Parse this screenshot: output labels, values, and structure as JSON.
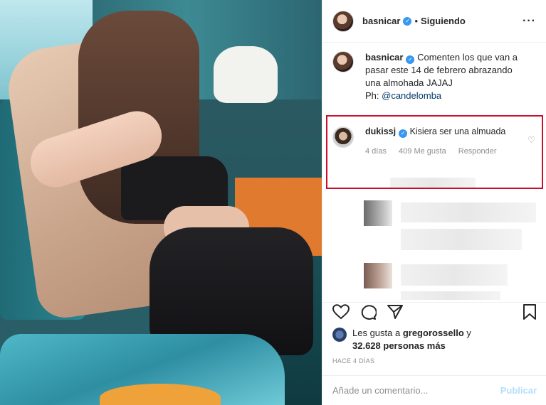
{
  "post": {
    "username": "basnicar",
    "following_label": "Siguiendo",
    "more_icon": "more-options-icon"
  },
  "caption": {
    "username": "basnicar",
    "text": "Comenten los que van a pasar este 14 de febrero abrazando una almohada JAJAJ",
    "credit_prefix": "Ph: ",
    "credit_mention": "@candelomba"
  },
  "highlighted_comment": {
    "username": "dukissj",
    "text": "Kisiera ser una almuada",
    "age": "4 días",
    "likes": "409 Me gusta",
    "reply_label": "Responder"
  },
  "likes": {
    "prefix": "Les gusta a ",
    "user": "gregorossello",
    "suffix": " y",
    "count": "32.628 personas más"
  },
  "timestamp": "HACE 4 DÍAS",
  "add_comment": {
    "placeholder": "Añade un comentario...",
    "post_label": "Publicar"
  },
  "colors": {
    "verified": "#3897f0",
    "highlight_border": "#c8102e",
    "link": "#00376b",
    "post_disabled": "#b2dffc"
  }
}
